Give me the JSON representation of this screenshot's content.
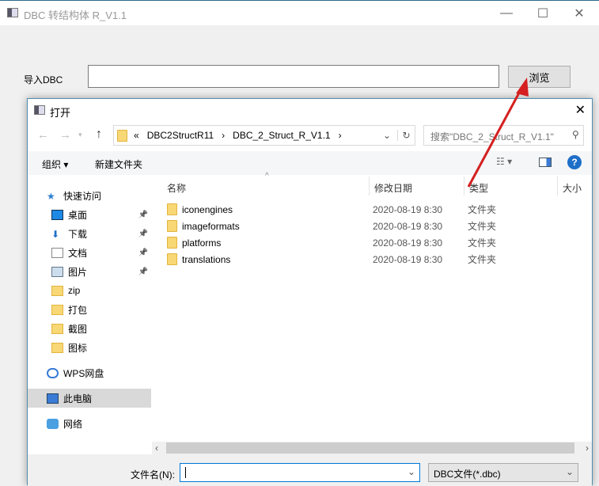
{
  "window": {
    "title": "DBC 转结构体 R_V1.1",
    "minimize": "—",
    "maximize": "☐",
    "close": "✕"
  },
  "main": {
    "import_label": "导入DBC",
    "browse_label": "浏览",
    "dbc_path": ""
  },
  "dialog": {
    "title": "打开",
    "close": "✕",
    "address": {
      "prefix": "«",
      "crumbs": [
        "DBC2StructR11",
        "DBC_2_Struct_R_V1.1"
      ],
      "sep": "›"
    },
    "search_placeholder": "搜索\"DBC_2_Struct_R_V1.1\"",
    "toolbar": {
      "organize": "组织 ▾",
      "new_folder": "新建文件夹"
    },
    "nav": [
      {
        "label": "快速访问",
        "icon": "star-icon"
      },
      {
        "label": "桌面",
        "icon": "desktop-icon",
        "pinned": true
      },
      {
        "label": "下载",
        "icon": "download-icon",
        "pinned": true
      },
      {
        "label": "文档",
        "icon": "document-icon",
        "pinned": true
      },
      {
        "label": "图片",
        "icon": "picture-icon",
        "pinned": true
      },
      {
        "label": "zip",
        "icon": "folder-icon"
      },
      {
        "label": "打包",
        "icon": "folder-icon"
      },
      {
        "label": "截图",
        "icon": "folder-icon"
      },
      {
        "label": "图标",
        "icon": "folder-icon"
      },
      {
        "label": "WPS网盘",
        "icon": "cloud-icon"
      },
      {
        "label": "此电脑",
        "icon": "computer-icon",
        "selected": true
      },
      {
        "label": "网络",
        "icon": "network-icon"
      }
    ],
    "columns": [
      "名称",
      "修改日期",
      "类型",
      "大小"
    ],
    "files": [
      {
        "name": "iconengines",
        "date": "2020-08-19 8:30",
        "type": "文件夹"
      },
      {
        "name": "imageformats",
        "date": "2020-08-19 8:30",
        "type": "文件夹"
      },
      {
        "name": "platforms",
        "date": "2020-08-19 8:30",
        "type": "文件夹"
      },
      {
        "name": "translations",
        "date": "2020-08-19 8:30",
        "type": "文件夹"
      }
    ],
    "filename_label": "文件名(N):",
    "filename_value": "",
    "filetype": "DBC文件(*.dbc)"
  },
  "colors": {
    "accent": "#0078d7",
    "arrow": "#d42020",
    "folder": "#f8d775"
  }
}
